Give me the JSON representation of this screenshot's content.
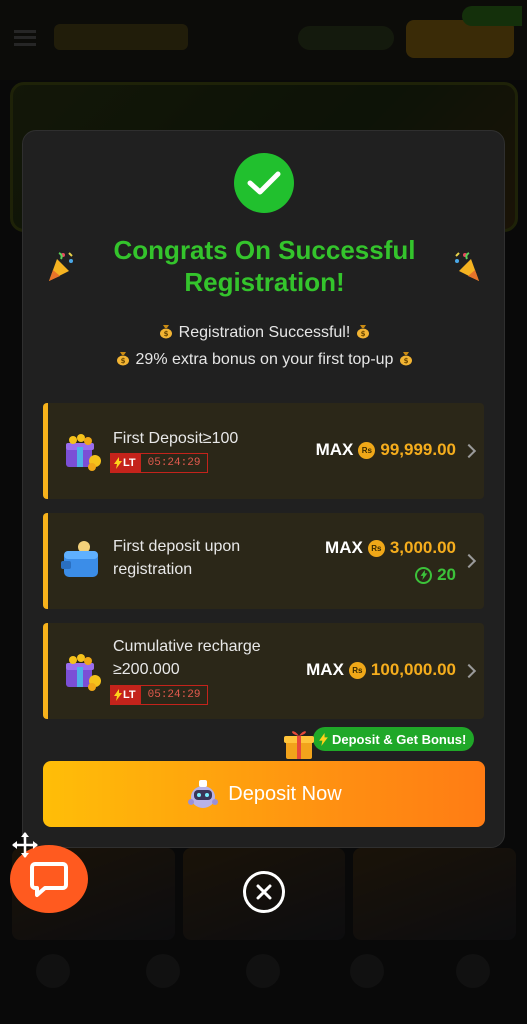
{
  "modal": {
    "title": "Congrats On Successful Registration!",
    "subtitle_line1": "Registration Successful!",
    "subtitle_line2": "29% extra bonus on your first top-up",
    "cards": [
      {
        "title": "First Deposit≥100",
        "badge": "LT",
        "timer": "05:24:29",
        "max_label": "MAX",
        "currency": "Rs",
        "amount": "99,999.00"
      },
      {
        "title": "First deposit upon registration",
        "max_label": "MAX",
        "currency": "Rs",
        "amount": "3,000.00",
        "extra": "20"
      },
      {
        "title": "Cumulative recharge ≥200.000",
        "badge": "LT",
        "timer": "05:24:29",
        "max_label": "MAX",
        "currency": "Rs",
        "amount": "100,000.00"
      }
    ],
    "promo_pill": "Deposit & Get Bonus!",
    "deposit_button": "Deposit Now"
  },
  "icons": {
    "success": "check-circle-icon",
    "confetti": "party-popper-icon",
    "money_bag": "money-bag-icon",
    "treasure": "treasure-box-icon",
    "wallet": "wallet-icon",
    "bolt": "lightning-icon",
    "gift": "gift-icon",
    "robot": "robot-mascot-icon",
    "close": "close-icon",
    "chat": "chat-icon",
    "move": "move-icon"
  },
  "colors": {
    "accent_green": "#34c42c",
    "accent_orange": "#f5ad1d",
    "button_gradient_start": "#ffbe08",
    "button_gradient_end": "#ff7c14",
    "card_bg": "#2b2718",
    "timer_red": "#c4231b"
  }
}
